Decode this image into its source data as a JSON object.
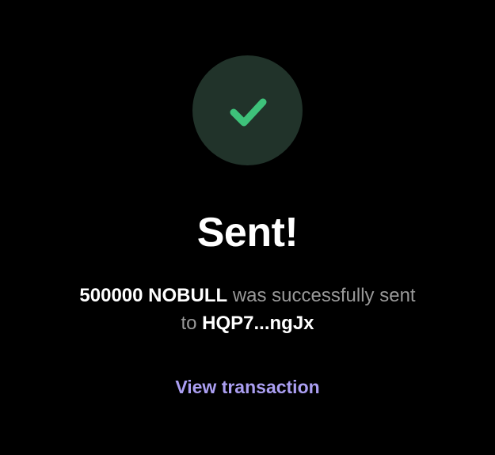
{
  "status": {
    "icon": "checkmark-icon",
    "title": "Sent!"
  },
  "message": {
    "amount": "500000 NOBULL",
    "text_middle": " was successfully ",
    "text_sent_to": "sent to ",
    "recipient": "HQP7...ngJx"
  },
  "actions": {
    "view_transaction_label": "View transaction"
  },
  "colors": {
    "background": "#000000",
    "icon_circle": "#21332a",
    "check": "#3ec27a",
    "link": "#ab9ff2",
    "muted_text": "#999999"
  }
}
